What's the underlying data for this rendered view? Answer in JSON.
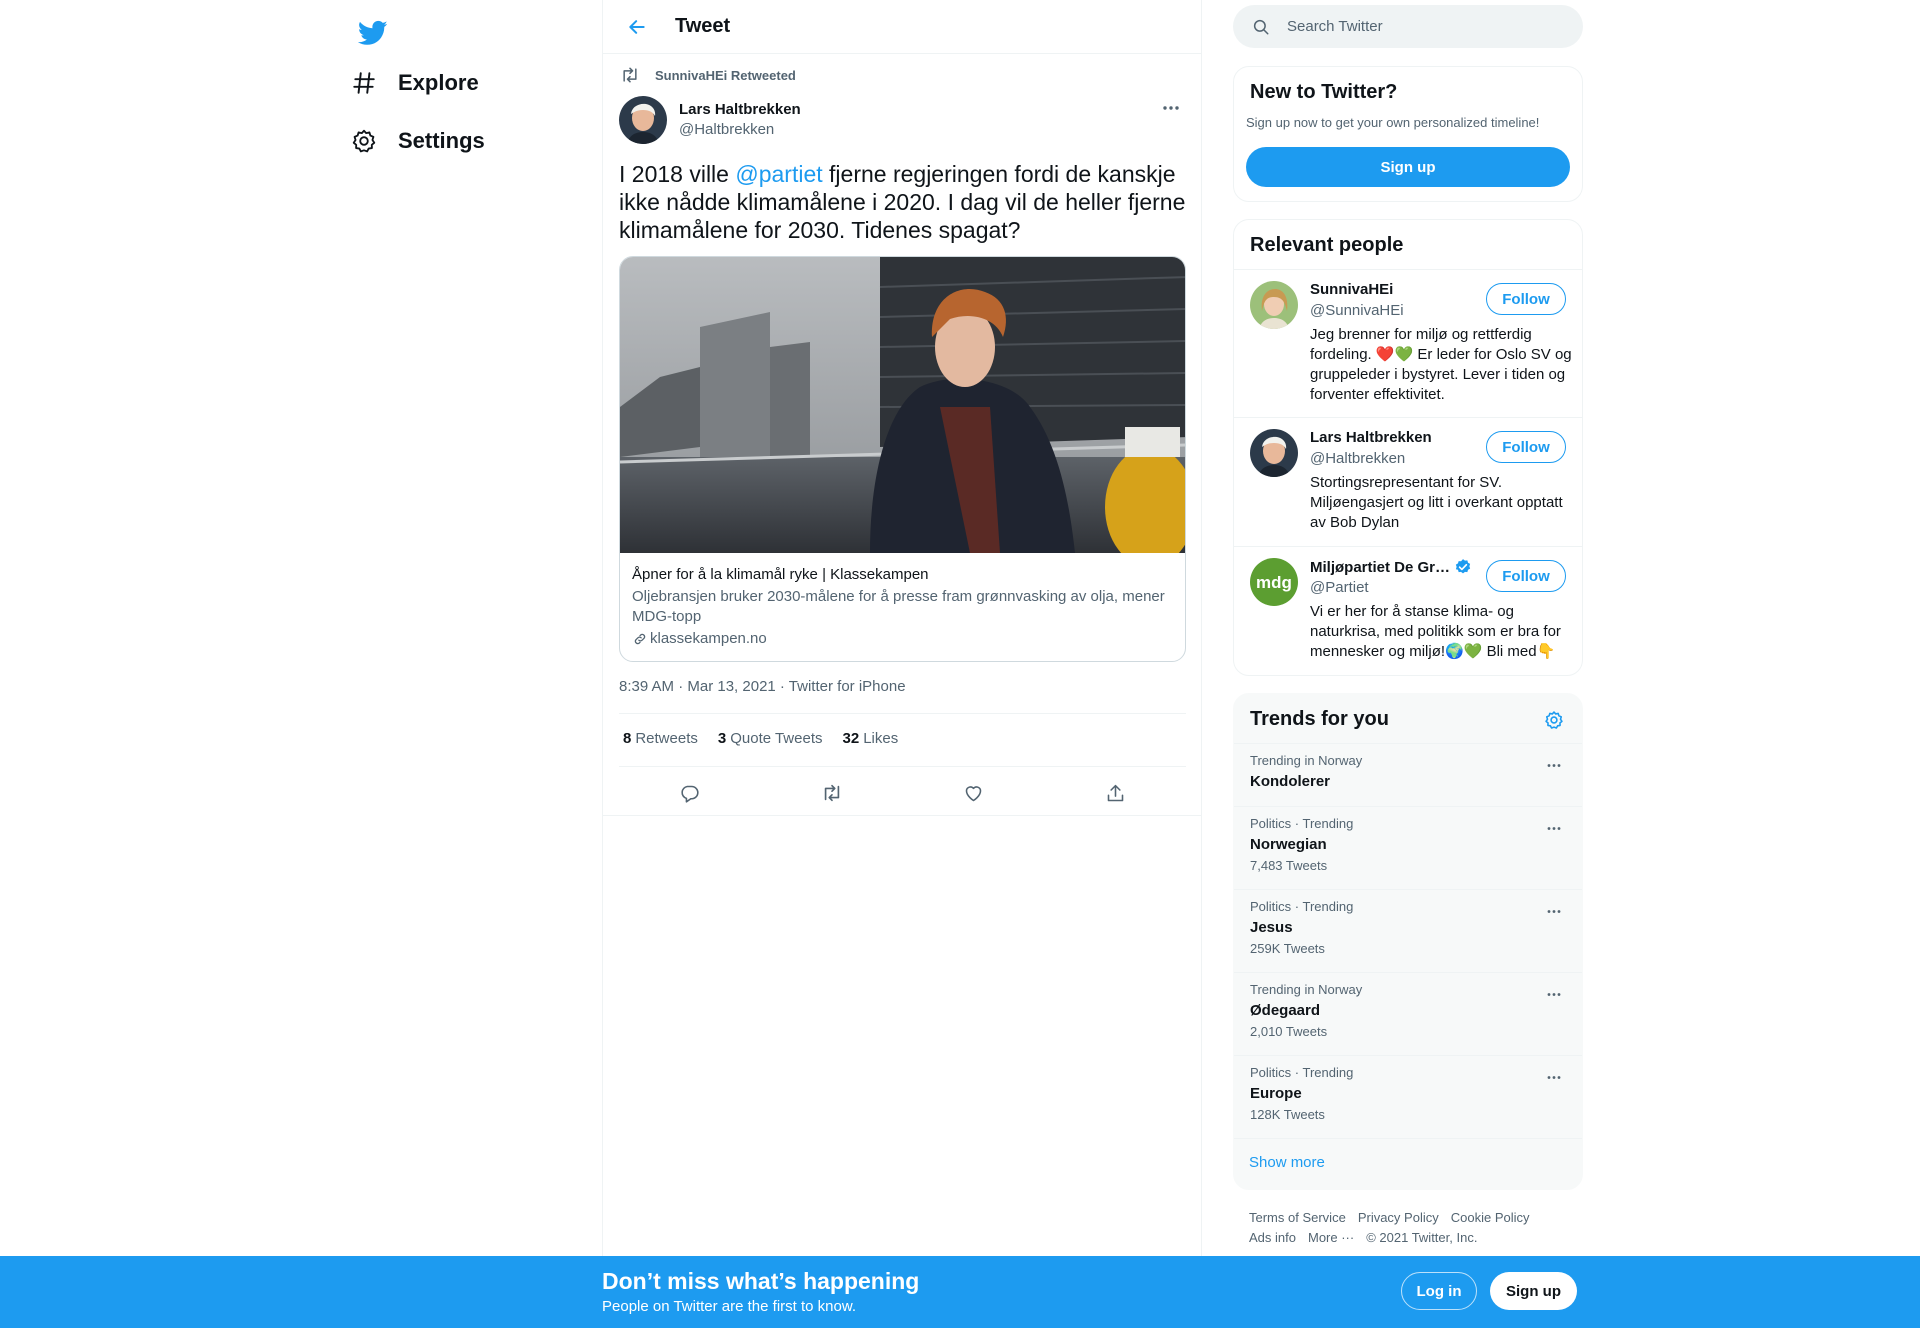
{
  "colors": {
    "accent": "#1d9bf0",
    "text": "#0f1419",
    "muted": "#536471",
    "border": "#eff3f4"
  },
  "nav": {
    "logo_icon": "twitter-bird-icon",
    "items": [
      {
        "label": "Explore",
        "icon": "hashtag-icon"
      },
      {
        "label": "Settings",
        "icon": "gear-icon"
      }
    ]
  },
  "header": {
    "title": "Tweet",
    "back_icon": "arrow-left-icon"
  },
  "tweet": {
    "retweeted_by": "SunnivaHEi Retweeted",
    "author_name": "Lars Haltbrekken",
    "author_handle": "@Haltbrekken",
    "text_before": "I 2018 ville ",
    "mention": "@partiet",
    "text_after": " fjerne regjeringen fordi de kanskje ikke nådde klimamålene i 2020. I dag vil de heller fjerne klimamålene for 2030. Tidenes spagat?",
    "card": {
      "title": "Åpner for å la klimamål ryke | Klassekampen",
      "description": "Oljebransjen bruker 2030-målene for å presse fram grønnvasking av olja, mener MDG-topp",
      "domain": "klassekampen.no"
    },
    "timestamp": "8:39 AM · Mar 13, 2021 · Twitter for iPhone",
    "stats": [
      {
        "count": "8",
        "label": "Retweets"
      },
      {
        "count": "3",
        "label": "Quote Tweets"
      },
      {
        "count": "32",
        "label": "Likes"
      }
    ]
  },
  "search": {
    "placeholder": "Search Twitter"
  },
  "new_to_twitter": {
    "title": "New to Twitter?",
    "subtitle": "Sign up now to get your own personalized timeline!",
    "button": "Sign up"
  },
  "relevant_people": {
    "title": "Relevant people",
    "people": [
      {
        "name": "SunnivaHEi",
        "handle": "@SunnivaHEi",
        "bio": "Jeg brenner for miljø og rettferdig fordeling. ❤️💚 Er leder for Oslo SV og gruppeleder i bystyret. Lever i tiden og forventer effektivitet.",
        "follow": "Follow"
      },
      {
        "name": "Lars Haltbrekken",
        "handle": "@Haltbrekken",
        "bio": "Stortingsrepresentant for SV. Miljøengasjert og litt i overkant opptatt av Bob Dylan",
        "follow": "Follow"
      },
      {
        "name": "Miljøpartiet De Gr…",
        "handle": "@Partiet",
        "bio": "Vi er her for å stanse klima- og naturkrisa, med politikk som er bra for mennesker og miljø!🌍💚 Bli med👇",
        "follow": "Follow",
        "avatar_text": "mdg"
      }
    ]
  },
  "trends": {
    "title": "Trends for you",
    "items": [
      {
        "context": "Trending in Norway",
        "name": "Kondolerer",
        "count": ""
      },
      {
        "context": "Politics · Trending",
        "name": "Norwegian",
        "count": "7,483 Tweets"
      },
      {
        "context": "Politics · Trending",
        "name": "Jesus",
        "count": "259K Tweets"
      },
      {
        "context": "Trending in Norway",
        "name": "Ødegaard",
        "count": "2,010 Tweets"
      },
      {
        "context": "Politics · Trending",
        "name": "Europe",
        "count": "128K Tweets"
      }
    ],
    "show_more": "Show more"
  },
  "footer": {
    "links": [
      "Terms of Service",
      "Privacy Policy",
      "Cookie Policy",
      "Ads info",
      "More ···"
    ],
    "copyright": "© 2021 Twitter, Inc."
  },
  "bottom_bar": {
    "title": "Don’t miss what’s happening",
    "subtitle": "People on Twitter are the first to know.",
    "login": "Log in",
    "signup": "Sign up"
  }
}
